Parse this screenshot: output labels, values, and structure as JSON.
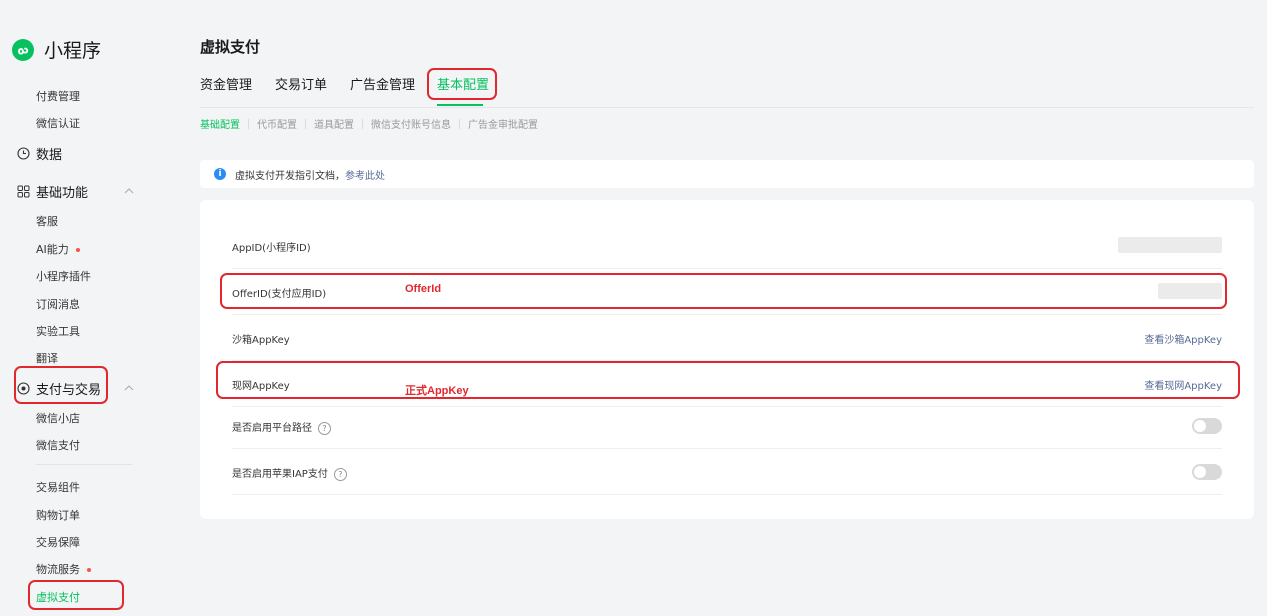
{
  "app": {
    "name": "小程序"
  },
  "sidebar": {
    "items": {
      "fee": "付费管理",
      "wxauth": "微信认证",
      "data": "数据",
      "basic": "基础功能",
      "kefu": "客服",
      "ai": "AI能力",
      "plugin": "小程序插件",
      "subscribe": "订阅消息",
      "lab": "实验工具",
      "translate": "翻译",
      "pay": "支付与交易",
      "shop": "微信小店",
      "wxpay": "微信支付",
      "trade_comp": "交易组件",
      "orders": "购物订单",
      "guarantee": "交易保障",
      "logistics": "物流服务",
      "virtual_pay": "虚拟支付"
    }
  },
  "page": {
    "title": "虚拟支付"
  },
  "tabs": {
    "t0": "资金管理",
    "t1": "交易订单",
    "t2": "广告金管理",
    "t3": "基本配置"
  },
  "subtabs": {
    "s0": "基础配置",
    "s1": "代币配置",
    "s2": "道具配置",
    "s3": "微信支付账号信息",
    "s4": "广告金审批配置"
  },
  "notice": {
    "text": "虚拟支付开发指引文档，",
    "link": "参考此处"
  },
  "config": {
    "appid_label": "AppID(小程序ID)",
    "offerid_label": "OfferID(支付应用ID)",
    "sandbox_label": "沙箱AppKey",
    "sandbox_action": "查看沙箱AppKey",
    "live_label": "现网AppKey",
    "live_action": "查看现网AppKey",
    "platform_path_label": "是否启用平台路径",
    "iap_label": "是否启用苹果IAP支付",
    "platform_path_enabled": false,
    "iap_enabled": false
  },
  "annotations": {
    "offerid": "OfferId",
    "appkey": "正式AppKey"
  },
  "colors": {
    "accent": "#07c160",
    "link": "#576b95",
    "annotation": "#e0282e",
    "info": "#2c8cf4"
  }
}
